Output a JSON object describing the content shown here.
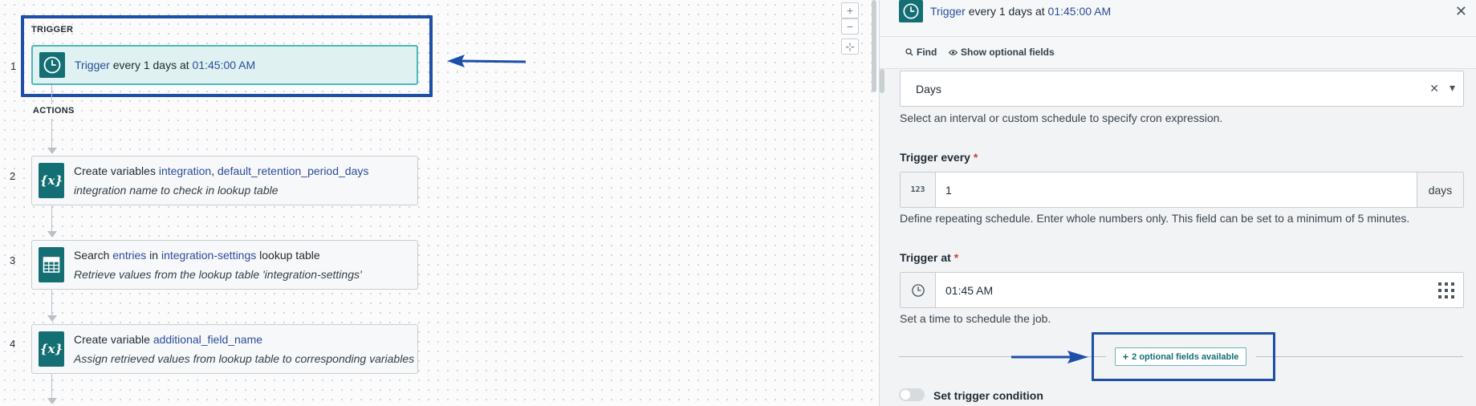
{
  "canvas": {
    "trigger_section_label": "TRIGGER",
    "actions_section_label": "ACTIONS",
    "trigger": {
      "number": "1",
      "keyword": "Trigger",
      "text_mid": " every 1 days at ",
      "time": "01:45:00 AM"
    },
    "steps": [
      {
        "number": "2",
        "icon": "variable-icon",
        "prefix": "Create variables ",
        "highlight1": "integration",
        "sep": ", ",
        "highlight2": "default_retention_period_days",
        "suffix": "",
        "description": "integration name to check in lookup table"
      },
      {
        "number": "3",
        "icon": "table-icon",
        "prefix": "Search ",
        "highlight1": "entries",
        "sep": " in ",
        "highlight2": "integration-settings",
        "suffix": " lookup table",
        "description": "Retrieve values from the lookup table 'integration-settings'"
      },
      {
        "number": "4",
        "icon": "variable-icon",
        "prefix": "Create variable ",
        "highlight1": "additional_field_name",
        "sep": "",
        "highlight2": "",
        "suffix": "",
        "description": "Assign retrieved values from lookup table to corresponding variables"
      }
    ],
    "zoom_controls": {
      "zoom_in": "+",
      "zoom_out": "−",
      "fit": "⊹"
    }
  },
  "panel": {
    "header": {
      "keyword": "Trigger",
      "text_mid": " every 1 days at ",
      "time": "01:45:00 AM",
      "close": "✕"
    },
    "toolbar": {
      "find_label": "Find",
      "optional_label": "Show optional fields"
    },
    "schedule_select": {
      "value": "Days",
      "clear": "✕",
      "chevron": "▾",
      "hint": "Select an interval or custom schedule to specify cron expression."
    },
    "trigger_every": {
      "label": "Trigger every",
      "required_mark": "*",
      "prefix": "123",
      "value": "1",
      "suffix": "days",
      "hint": "Define repeating schedule. Enter whole numbers only. This field can be set to a minimum of 5 minutes."
    },
    "trigger_at": {
      "label": "Trigger at",
      "required_mark": "*",
      "value": "01:45 AM",
      "hint": "Set a time to schedule the job."
    },
    "optional_fields_button": "2 optional fields available",
    "trigger_condition_label": "Set trigger condition"
  },
  "colors": {
    "teal": "#136f74",
    "link_blue": "#2a4d9b",
    "annotation_blue": "#1d4fa8",
    "required_red": "#d23a3a"
  }
}
